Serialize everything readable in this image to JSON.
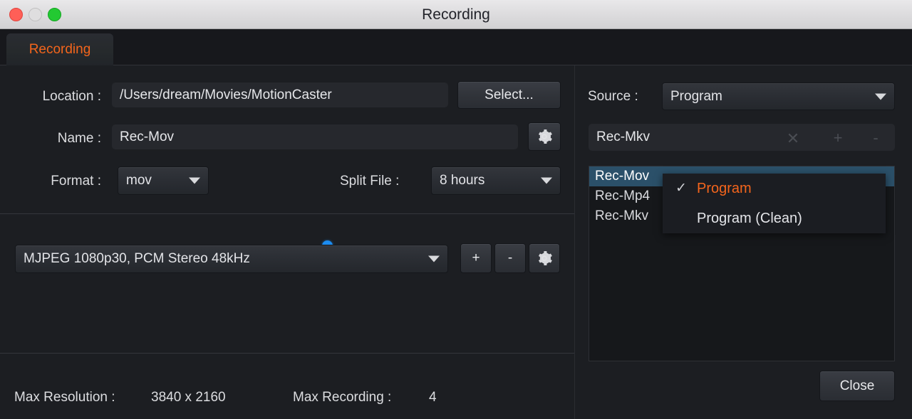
{
  "window": {
    "title": "Recording",
    "traffic_lights": [
      "close-red",
      "minimize-disabled",
      "zoom-green"
    ]
  },
  "tab": {
    "label": "Recording",
    "accent_color": "#f4651c"
  },
  "left_panel": {
    "location": {
      "label": "Location :",
      "value": "/Users/dream/Movies/MotionCaster",
      "select_button": "Select..."
    },
    "name": {
      "label": "Name :",
      "value": "Rec-Mov",
      "settings_icon": "gear-icon"
    },
    "format": {
      "label": "Format :",
      "value": "mov"
    },
    "split_file": {
      "label": "Split File :",
      "value": "8 hours",
      "led_color": "#1c8cf0",
      "enabled": true
    },
    "codec": {
      "value": "MJPEG 1080p30, PCM Stereo 48kHz",
      "add_button": "+",
      "remove_button": "-",
      "settings_icon": "gear-icon"
    },
    "status": {
      "max_resolution_label": "Max Resolution :",
      "max_resolution_value": "3840 x 2160",
      "max_recording_label": "Max Recording :",
      "max_recording_value": "4"
    }
  },
  "right_panel": {
    "source": {
      "label": "Source :",
      "value": "Program"
    },
    "preset_field": {
      "value": "Rec-Mkv",
      "clear_icon": "clear-circle-icon",
      "add_button": "+",
      "remove_button": "-"
    },
    "list": {
      "items": [
        {
          "label": "Rec-Mov",
          "selected": true
        },
        {
          "label": "Rec-Mp4",
          "selected": false
        },
        {
          "label": "Rec-Mkv",
          "selected": false
        }
      ]
    },
    "close_button": "Close"
  },
  "dropdown_menu": {
    "open": true,
    "check_glyph": "✓",
    "items": [
      {
        "label": "Program",
        "checked": true
      },
      {
        "label": "Program (Clean)",
        "checked": false
      }
    ]
  }
}
